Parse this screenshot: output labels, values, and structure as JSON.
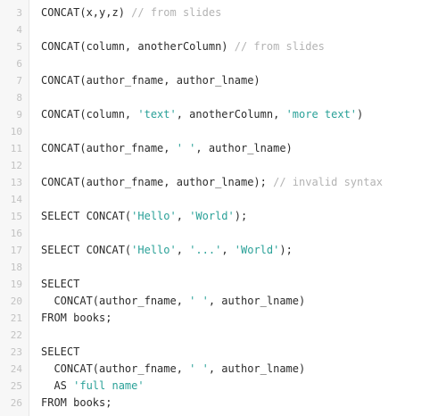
{
  "editor": {
    "lines": [
      {
        "num": "3",
        "tokens": [
          {
            "t": "plain",
            "v": "CONCAT(x,y,z) "
          },
          {
            "t": "comment",
            "v": "// from slides"
          }
        ]
      },
      {
        "num": "4",
        "tokens": []
      },
      {
        "num": "5",
        "tokens": [
          {
            "t": "plain",
            "v": "CONCAT(column, anotherColumn) "
          },
          {
            "t": "comment",
            "v": "// from slides"
          }
        ]
      },
      {
        "num": "6",
        "tokens": []
      },
      {
        "num": "7",
        "tokens": [
          {
            "t": "plain",
            "v": "CONCAT(author_fname, author_lname)"
          }
        ]
      },
      {
        "num": "8",
        "tokens": []
      },
      {
        "num": "9",
        "tokens": [
          {
            "t": "plain",
            "v": "CONCAT(column, "
          },
          {
            "t": "str",
            "v": "'text'"
          },
          {
            "t": "plain",
            "v": ", anotherColumn, "
          },
          {
            "t": "str",
            "v": "'more text'"
          },
          {
            "t": "plain",
            "v": ")"
          }
        ]
      },
      {
        "num": "10",
        "tokens": []
      },
      {
        "num": "11",
        "tokens": [
          {
            "t": "plain",
            "v": "CONCAT(author_fname, "
          },
          {
            "t": "str",
            "v": "' '"
          },
          {
            "t": "plain",
            "v": ", author_lname)"
          }
        ]
      },
      {
        "num": "12",
        "tokens": []
      },
      {
        "num": "13",
        "tokens": [
          {
            "t": "plain",
            "v": "CONCAT(author_fname, author_lname); "
          },
          {
            "t": "comment",
            "v": "// invalid syntax"
          }
        ]
      },
      {
        "num": "14",
        "tokens": []
      },
      {
        "num": "15",
        "tokens": [
          {
            "t": "plain",
            "v": "SELECT CONCAT("
          },
          {
            "t": "str",
            "v": "'Hello'"
          },
          {
            "t": "plain",
            "v": ", "
          },
          {
            "t": "str",
            "v": "'World'"
          },
          {
            "t": "plain",
            "v": ");"
          }
        ]
      },
      {
        "num": "16",
        "tokens": []
      },
      {
        "num": "17",
        "tokens": [
          {
            "t": "plain",
            "v": "SELECT CONCAT("
          },
          {
            "t": "str",
            "v": "'Hello'"
          },
          {
            "t": "plain",
            "v": ", "
          },
          {
            "t": "str",
            "v": "'...'"
          },
          {
            "t": "plain",
            "v": ", "
          },
          {
            "t": "str",
            "v": "'World'"
          },
          {
            "t": "plain",
            "v": ");"
          }
        ]
      },
      {
        "num": "18",
        "tokens": []
      },
      {
        "num": "19",
        "tokens": [
          {
            "t": "plain",
            "v": "SELECT"
          }
        ]
      },
      {
        "num": "20",
        "tokens": [
          {
            "t": "plain",
            "v": "  CONCAT(author_fname, "
          },
          {
            "t": "str",
            "v": "' '"
          },
          {
            "t": "plain",
            "v": ", author_lname)"
          }
        ]
      },
      {
        "num": "21",
        "tokens": [
          {
            "t": "plain",
            "v": "FROM books;"
          }
        ]
      },
      {
        "num": "22",
        "tokens": []
      },
      {
        "num": "23",
        "tokens": [
          {
            "t": "plain",
            "v": "SELECT"
          }
        ]
      },
      {
        "num": "24",
        "tokens": [
          {
            "t": "plain",
            "v": "  CONCAT(author_fname, "
          },
          {
            "t": "str",
            "v": "' '"
          },
          {
            "t": "plain",
            "v": ", author_lname)"
          }
        ]
      },
      {
        "num": "25",
        "tokens": [
          {
            "t": "plain",
            "v": "  AS "
          },
          {
            "t": "str",
            "v": "'full name'"
          }
        ]
      },
      {
        "num": "26",
        "tokens": [
          {
            "t": "plain",
            "v": "FROM books;"
          }
        ]
      }
    ]
  },
  "colors": {
    "background": "#ffffff",
    "gutter": "#f7f7f7",
    "line_number": "#c2c2c2",
    "plain": "#2b2b2b",
    "string": "#2aa198",
    "comment": "#b3b3b3"
  }
}
